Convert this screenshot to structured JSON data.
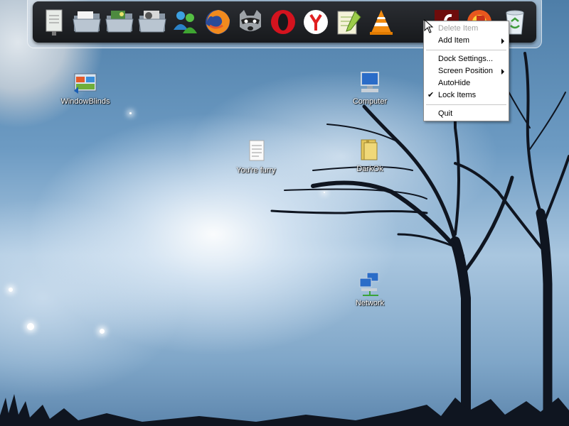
{
  "dock": {
    "items": [
      {
        "name": "notes-icon"
      },
      {
        "name": "folder-icon"
      },
      {
        "name": "folder-pictures-icon"
      },
      {
        "name": "folder-media-icon"
      },
      {
        "name": "messenger-icon"
      },
      {
        "name": "firefox-icon"
      },
      {
        "name": "raccoon-icon"
      },
      {
        "name": "opera-icon"
      },
      {
        "name": "yandex-icon"
      },
      {
        "name": "notepad-plus-icon"
      },
      {
        "name": "vlc-icon"
      },
      {
        "name": "flash-icon"
      },
      {
        "name": "paint-icon"
      },
      {
        "name": "recycle-bin-icon"
      }
    ]
  },
  "desktop_icons": [
    {
      "label": "WindowBlinds"
    },
    {
      "label": "Computer"
    },
    {
      "label": "You're furry"
    },
    {
      "label": "DarkOk"
    },
    {
      "label": "Network"
    }
  ],
  "context_menu": {
    "items": [
      {
        "label": "Delete Item",
        "disabled": true
      },
      {
        "label": "Add Item",
        "submenu": true
      },
      {
        "label": "Dock Settings..."
      },
      {
        "label": "Screen Position",
        "submenu": true
      },
      {
        "label": "AutoHide"
      },
      {
        "label": "Lock Items",
        "checked": true
      },
      {
        "label": "Quit"
      }
    ]
  },
  "colors": {
    "dock_bg": "#1e2024",
    "sky_accent": "#6d9bc3",
    "menu_bg": "#ffffff"
  }
}
